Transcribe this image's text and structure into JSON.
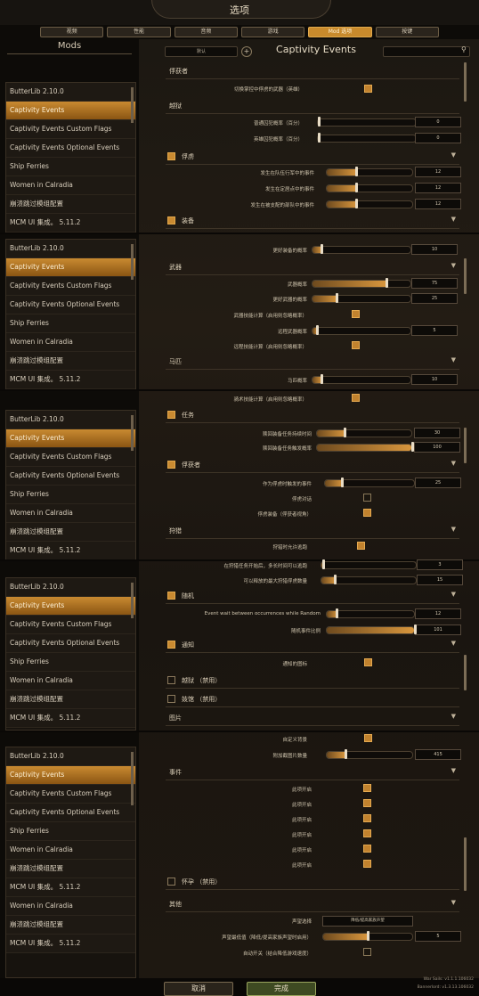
{
  "window": {
    "title": "选项"
  },
  "tabs": [
    {
      "label": "视频",
      "active": false
    },
    {
      "label": "性能",
      "active": false
    },
    {
      "label": "音频",
      "active": false
    },
    {
      "label": "游戏",
      "active": false
    },
    {
      "label": "Mod 选项",
      "active": true
    },
    {
      "label": "按键",
      "active": false
    }
  ],
  "mods": {
    "header": "Mods",
    "list": [
      "ButterLib 2.10.0",
      "Captivity Events",
      "Captivity Events Custom Flags",
      "Captivity Events Optional Events",
      "Ship Ferries",
      "Women in Calradia",
      "崩溃跳过模组配置",
      "MCM UI 集成。 5.11.2"
    ],
    "list_extra": [
      "Women in Calradia",
      "崩溃跳过模组配置",
      "MCM UI 集成。 5.11.2"
    ],
    "active": "Captivity Events"
  },
  "settings": {
    "search_left": "默认",
    "mod_title": "Captivity Events",
    "p1": {
      "section_captor": "俘获者",
      "switch_captor_skill": "切换掌控中俘虏的武器（英雄）",
      "section_escape": "越狱",
      "normal_escape": "普通囚犯概率（百分）",
      "normal_escape_val": "0",
      "hero_escape": "英雄囚犯概率（百分）",
      "hero_escape_val": "0",
      "section_captive": "俘虏",
      "ev_army": "发生在队伍行军中的事件",
      "ev_army_val": "12",
      "ev_settlement": "发生在定居点中的事件",
      "ev_settlement_val": "12",
      "ev_party": "发生在被支配的部队中的事件",
      "ev_party_val": "12",
      "section_equipment": "装备"
    },
    "p2": {
      "strip_chance": "更好装备的概率",
      "strip_chance_val": "10",
      "section_weapons": "武器",
      "weapon_chance": "武器概率",
      "weapon_chance_val": "75",
      "better_weapon": "更好武器的概率",
      "better_weapon_val": "25",
      "weapon_skill": "武器技能计算（启用则忽略概率）",
      "ranged_chance": "远程武器概率",
      "ranged_chance_val": "5",
      "ranged_skill": "远程技能计算（启用则忽略概率）",
      "section_horse": "马匹",
      "horse_chance": "马匹概率",
      "horse_chance_val": "10"
    },
    "p3": {
      "horse_skill": "骑术技能计算（启用则忽略概率）",
      "section_quest": "任务",
      "quest_time": "赎回装备任务持续时间",
      "quest_time_val": "30",
      "quest_trigger": "赎回装备任务触发概率",
      "quest_trigger_val": "100",
      "section_captor2": "俘获者",
      "captor_trigger": "作为俘虏时触发的事件",
      "captor_trigger_val": "25",
      "captor_talk": "俘虏对话",
      "captor_gear": "俘虏装备（俘获者视角）",
      "section_hunt": "狩猎",
      "hunt_allow": "狩猎时允许逃跑"
    },
    "p4": {
      "hunt_time": "在狩猎任务开始后，多长时间可以逃跑",
      "hunt_time_val": "3",
      "hunt_max": "可以释放的最大狩猎俘虏数量",
      "hunt_max_val": "15",
      "section_random": "随机",
      "random_wait": "Event wait between occurrences while Random",
      "random_wait_val": "12",
      "random_ratio": "随机事件比例",
      "random_ratio_val": "101",
      "section_notify": "通知",
      "notify_icon": "通知的图标",
      "section_jailbreak": "越狱 （禁用）",
      "section_brothel": "妓馆 （禁用）",
      "section_images": "图片"
    },
    "p5": {
      "custom_bg": "自定义背景",
      "image_count": "附加截图片数量",
      "image_count_val": "415",
      "section_events": "事件",
      "toggles": [
        "此项开启",
        "此项开启",
        "此项开启",
        "此项开启",
        "此项开启",
        "此项开启"
      ],
      "section_pregnancy": "怀孕 （禁用）",
      "section_other": "其他",
      "renown_select": "声望选择",
      "renown_select_val": "降低/提高家族声望",
      "renown_value": "声望最低值（降低/提高家族声望时启用）",
      "renown_value_val": "5",
      "auto_toggle": "自动开关（结合降低游戏速度）"
    }
  },
  "footer": {
    "cancel": "取消",
    "done": "完成",
    "version1": "War Sails: v1.1.1.106032",
    "version2": "Bannerlord: v1.3.13.106032"
  }
}
